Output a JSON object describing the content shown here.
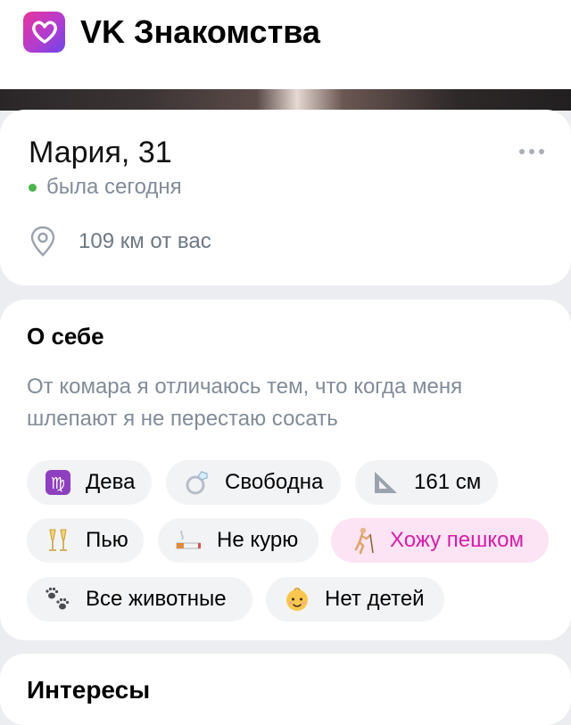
{
  "header": {
    "app_title": "VK Знакомства",
    "logo_icon": "heart-logo-icon"
  },
  "profile": {
    "name_age": "Мария, 31",
    "status": "была сегодня",
    "status_color": "#4bb34b",
    "distance": "109 км от вас"
  },
  "about": {
    "title": "О себе",
    "text": "От комара я отличаюсь тем, что когда меня шлепают я не перестаю сосать",
    "chips": [
      {
        "icon": "virgo-icon",
        "label": "Дева"
      },
      {
        "icon": "ring-icon",
        "label": "Свободна"
      },
      {
        "icon": "ruler-icon",
        "label": "161 см"
      },
      {
        "icon": "champagne-icon",
        "label": "Пью"
      },
      {
        "icon": "cigarette-icon",
        "label": "Не курю"
      },
      {
        "icon": "hiking-icon",
        "label": "Хожу пешком",
        "highlighted": true
      },
      {
        "icon": "paw-prints-icon",
        "label": "Все животные"
      },
      {
        "icon": "baby-icon",
        "label": "Нет детей"
      }
    ]
  },
  "interests": {
    "title": "Интересы"
  },
  "colors": {
    "accent_pink": "#d61eaa",
    "chip_bg": "#f2f3f5",
    "secondary_text": "#818c99"
  }
}
